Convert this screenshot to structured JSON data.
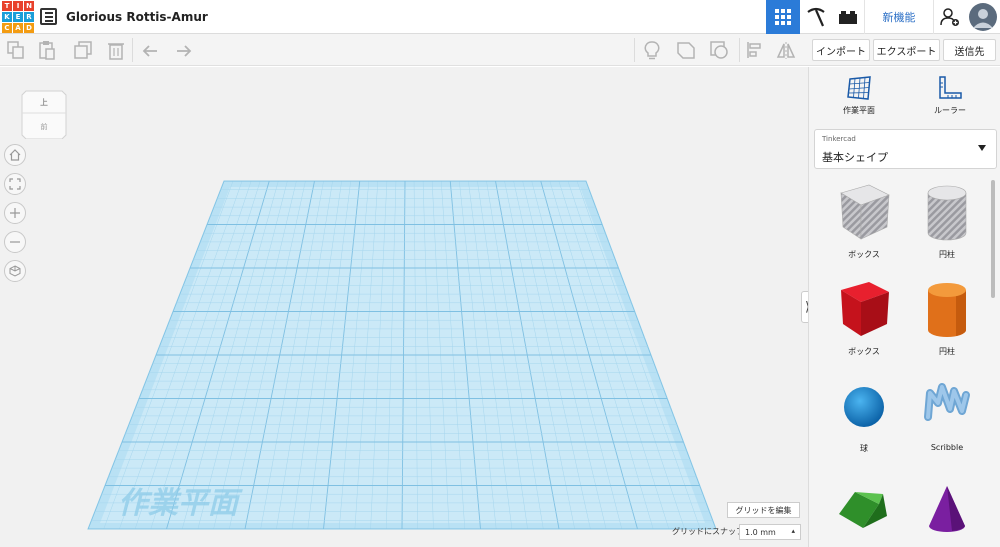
{
  "app": {
    "logo_letters": [
      "T",
      "I",
      "N",
      "K",
      "E",
      "R",
      "C",
      "A",
      "D"
    ],
    "logo_colors": [
      "#e8412c",
      "#e8412c",
      "#e8412c",
      "#1a9ed9",
      "#1a9ed9",
      "#1a9ed9",
      "#f39c12",
      "#f39c12",
      "#f39c12"
    ],
    "document_title": "Glorious Rottis-Amur",
    "new_features_label": "新機能",
    "accent_color": "#2b7bd8"
  },
  "toolbar": {
    "import_label": "インポート",
    "export_label": "エクスポート",
    "send_label": "送信先"
  },
  "viewcube": {
    "top_label": "上",
    "front_label": "前"
  },
  "workplane": {
    "watermark": "作業平面",
    "edit_grid_label": "グリッドを編集",
    "snap_label": "グリッドにスナップ",
    "snap_value": "1.0 mm"
  },
  "panel": {
    "workplane_tool_label": "作業平面",
    "ruler_tool_label": "ルーラー",
    "library_source": "Tinkercad",
    "library_name": "基本シェイプ",
    "shapes": [
      {
        "name": "ボックス",
        "icon": "box-hole-icon"
      },
      {
        "name": "円柱",
        "icon": "cylinder-hole-icon"
      },
      {
        "name": "ボックス",
        "icon": "box-icon"
      },
      {
        "name": "円柱",
        "icon": "cylinder-icon"
      },
      {
        "name": "球",
        "icon": "sphere-icon"
      },
      {
        "name": "Scribble",
        "icon": "scribble-icon"
      },
      {
        "name": "",
        "icon": "roof-icon"
      },
      {
        "name": "",
        "icon": "cone-icon"
      }
    ]
  }
}
